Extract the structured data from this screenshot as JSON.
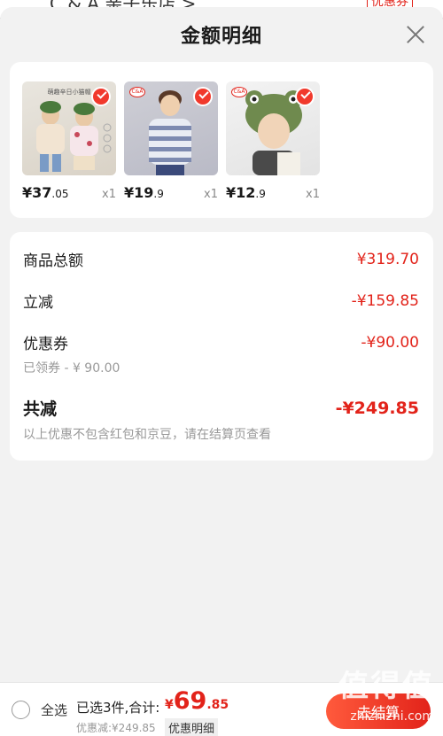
{
  "underlying": {
    "shop_text": "C & A 亲子乐店 >",
    "coupon_text": "优惠券"
  },
  "sheet": {
    "title": "金额明细"
  },
  "products": [
    {
      "price_int": "¥37",
      "price_dec": ".05",
      "qty": "x1",
      "banner": "萌趣辛日小猫帽"
    },
    {
      "price_int": "¥19",
      "price_dec": ".9",
      "qty": "x1",
      "brand": "C&A"
    },
    {
      "price_int": "¥12",
      "price_dec": ".9",
      "qty": "x1",
      "brand": "C&A"
    }
  ],
  "summary": {
    "total_label": "商品总额",
    "total_value": "¥319.70",
    "direct_label": "立减",
    "direct_value": "-¥159.85",
    "coupon_label": "优惠券",
    "coupon_value": "-¥90.00",
    "coupon_sub": "已领券 - ¥ 90.00",
    "sum_label": "共减",
    "sum_value": "-¥249.85",
    "note": "以上优惠不包含红包和京豆，请在结算页查看"
  },
  "bottom": {
    "select_all": "全选",
    "selected_info": "已选3件,合计:",
    "currency": "¥",
    "amount_int": "69",
    "amount_dec": ".85",
    "discount_line": "优惠减:¥249.85",
    "detail_link": "优惠明细",
    "checkout": "去结算"
  },
  "watermark": {
    "badge": "值得值",
    "url": "zhizhizhi.com"
  },
  "colors": {
    "accent_red": "#e2231a",
    "background": "#f2f2f2"
  }
}
